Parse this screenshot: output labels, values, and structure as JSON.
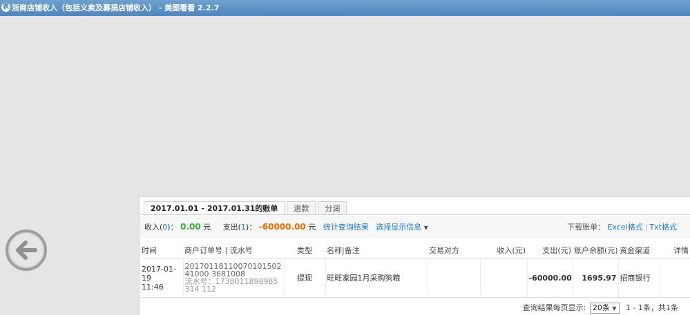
{
  "window": {
    "app_icon": "表",
    "title": "浙商店铺收入（包括义卖及募捐店铺收入） - 美图看看 2.2.7"
  },
  "nav": {
    "back_icon": "arrow-left-circle-icon"
  },
  "tabs": [
    {
      "label": "2017.01.01 - 2017.01.31的账单",
      "active": true
    },
    {
      "label": "退款",
      "active": false
    },
    {
      "label": "分润",
      "active": false
    }
  ],
  "summary": {
    "income_label": "收入(",
    "income_count": "0",
    "income_close": ")：",
    "income_amount": "0.00",
    "income_unit": "元",
    "expense_label": "支出(",
    "expense_count": "1",
    "expense_close": ")：",
    "expense_amount": "-60000.00",
    "expense_unit": "元",
    "stat_link": "统计查询结果",
    "display_link": "选择显示信息",
    "download_label": "下载账单：",
    "excel_link": "Excel格式",
    "separator": "|",
    "txt_link": "Txt格式"
  },
  "table": {
    "headers": [
      "时间",
      "商户订单号 | 流水号",
      "类型",
      "名称|备注",
      "交易对方",
      "收入(元)",
      "支出(元)",
      "账户余额(元)",
      "资金渠道",
      "详情"
    ],
    "rows": [
      {
        "date": "2017-01-19",
        "time": "11:46",
        "order_no": "2017011811007010150241000 3681008",
        "serial_label": "流水号：",
        "serial_no": "1738011898985314 112",
        "type": "提现",
        "name": "旺旺家园1月采购狗粮",
        "counterparty": "",
        "income": "",
        "expense": "-60000.00",
        "balance": "1695.97",
        "channel": "招商银行",
        "detail": ""
      }
    ]
  },
  "pager": {
    "per_page_label": "查询结果每页显示:",
    "per_page_value": "20条",
    "range_text": "1 - 1条，共1条"
  }
}
